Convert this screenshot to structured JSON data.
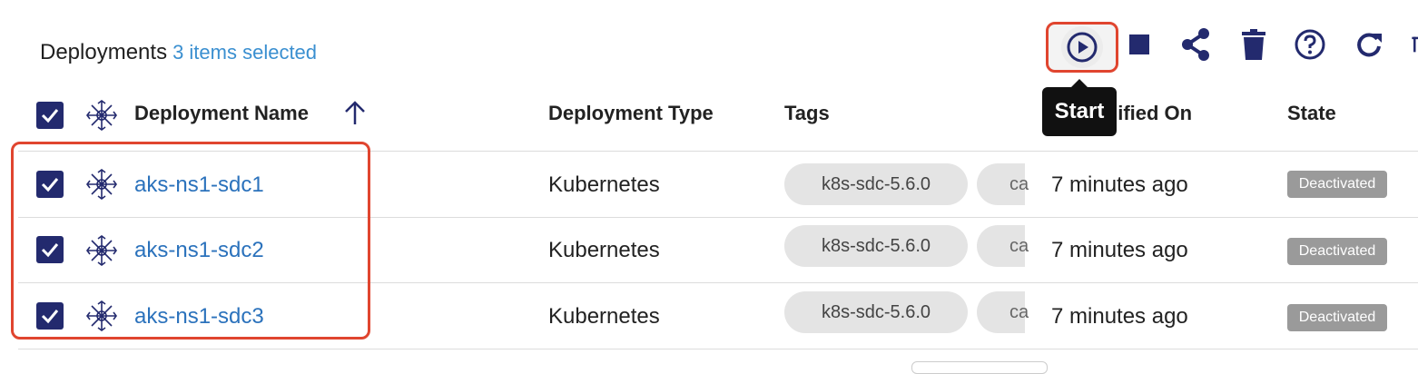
{
  "header": {
    "title": "Deployments",
    "selection_text": "3 items selected"
  },
  "toolbar": {
    "start_tooltip": "Start",
    "icons": [
      "play-circle-icon",
      "stop-icon",
      "share-icon",
      "trash-icon",
      "help-icon",
      "refresh-icon",
      "more-icon"
    ]
  },
  "table": {
    "columns": {
      "name": "Deployment Name",
      "type": "Deployment Type",
      "tags": "Tags",
      "modified": "Modified On",
      "state": "State"
    },
    "rows": [
      {
        "name": "aks-ns1-sdc1",
        "type": "Kubernetes",
        "tag1": "k8s-sdc-5.6.0",
        "tag2": "ca",
        "modified": "7 minutes ago",
        "state": "Deactivated",
        "checked": true
      },
      {
        "name": "aks-ns1-sdc2",
        "type": "Kubernetes",
        "tag1": "k8s-sdc-5.6.0",
        "tag2": "ca",
        "modified": "7 minutes ago",
        "state": "Deactivated",
        "checked": true
      },
      {
        "name": "aks-ns1-sdc3",
        "type": "Kubernetes",
        "tag1": "k8s-sdc-5.6.0",
        "tag2": "ca",
        "modified": "7 minutes ago",
        "state": "Deactivated",
        "checked": true
      }
    ]
  },
  "colors": {
    "accent": "#232a6e",
    "link": "#2b72bc",
    "highlight": "#e0452f",
    "badge": "#9a9a9a"
  }
}
